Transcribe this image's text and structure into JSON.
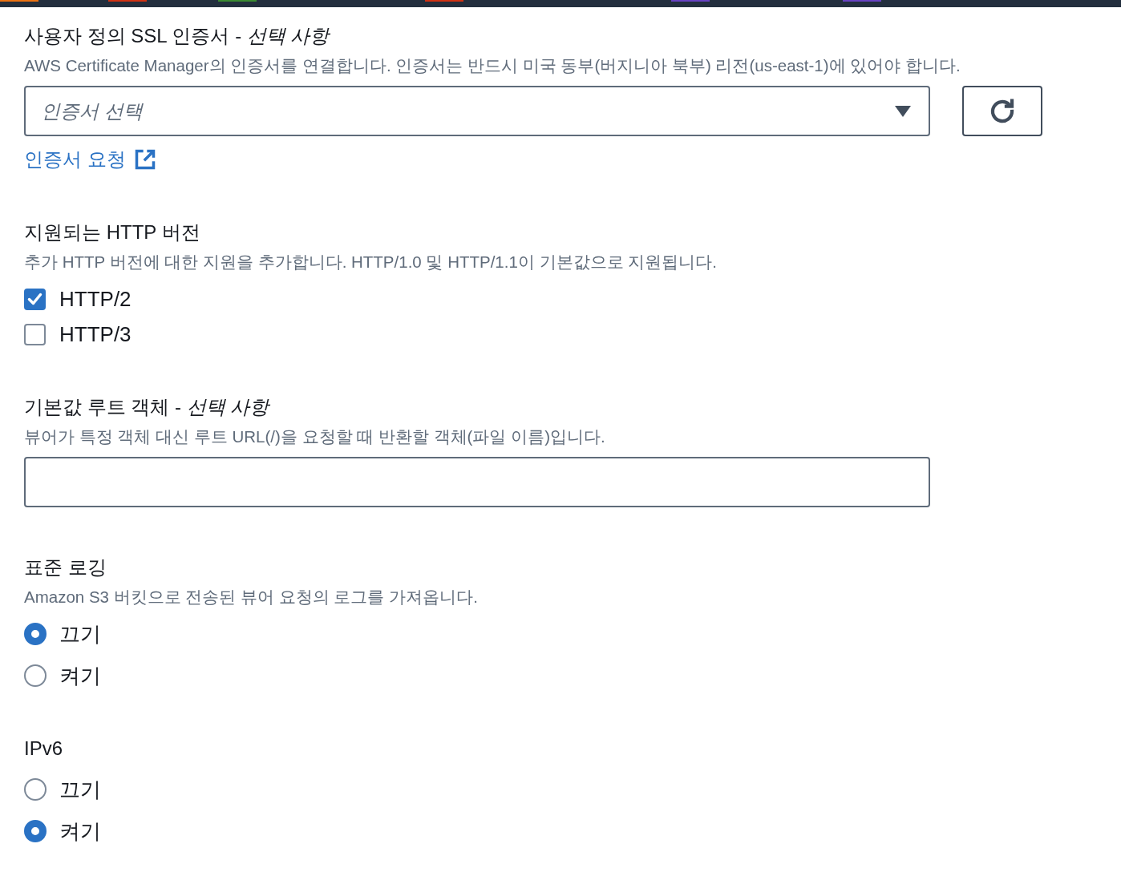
{
  "top_bar": {
    "markers": [
      {
        "color": "#ec7211"
      },
      {
        "color": "#d13212"
      },
      {
        "color": "#3b8a31"
      },
      {
        "color": "#d13212"
      },
      {
        "color": "#6842c2"
      },
      {
        "color": "#6842c2"
      }
    ]
  },
  "sections": [
    {
      "kind": "certificate",
      "label": "사용자 정의 SSL 인증서 - *선택 사항*",
      "description": "AWS Certificate Manager의 인증서를 연결합니다. 인증서는 반드시 미국 동부(버지니아 북부) 리전(us-east-1)에 있어야 합니다.",
      "select": {
        "placeholder": "인증서 선택"
      },
      "link": "인증서 요청"
    },
    {
      "kind": "checkboxes",
      "label": "지원되는 HTTP 버전",
      "description": "추가 HTTP 버전에 대한 지원을 추가합니다. HTTP/1.0 및 HTTP/1.1이 기본값으로 지원됩니다.",
      "options": [
        {
          "label": "HTTP/2",
          "checked": true
        },
        {
          "label": "HTTP/3",
          "checked": false
        }
      ]
    },
    {
      "kind": "text_input",
      "label": "기본값 루트 객체 - *선택 사항*",
      "description": "뷰어가 특정 객체 대신 루트 URL(/)을 요청할 때 반환할 객체(파일 이름)입니다."
    },
    {
      "kind": "radios",
      "label": "표준 로깅",
      "description": "Amazon S3 버킷으로 전송된 뷰어 요청의 로그를 가져옵니다.",
      "options": [
        {
          "label": "끄기",
          "selected": true
        },
        {
          "label": "켜기",
          "selected": false
        }
      ]
    },
    {
      "kind": "radios",
      "label": "IPv6",
      "options": [
        {
          "label": "끄기",
          "selected": false
        },
        {
          "label": "켜기",
          "selected": true
        }
      ]
    }
  ]
}
